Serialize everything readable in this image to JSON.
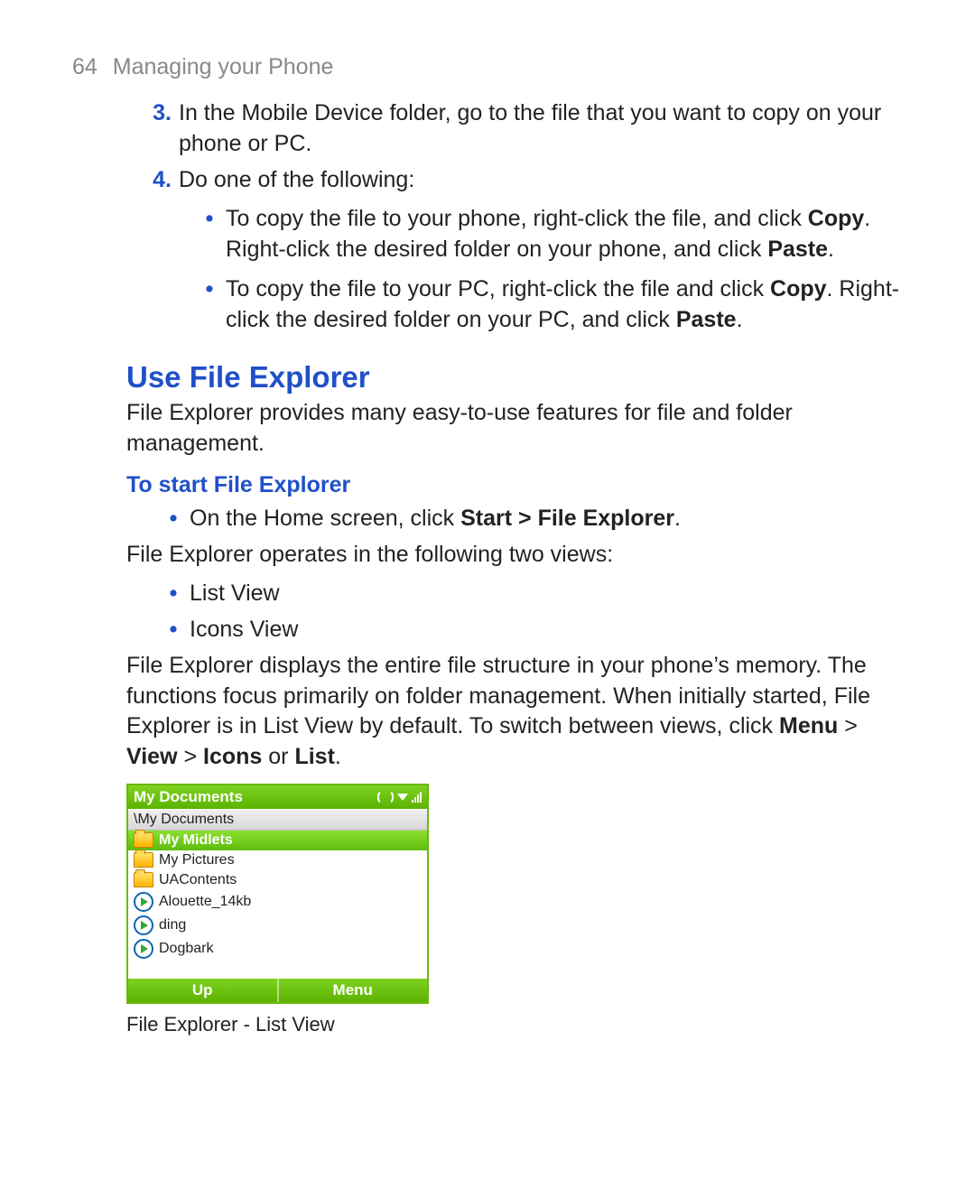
{
  "header": {
    "page_number": "64",
    "section_title": "Managing your Phone"
  },
  "steps": {
    "s3_num": "3.",
    "s3_text": "In the Mobile Device folder, go to the file that you want to copy on your phone or PC.",
    "s4_num": "4.",
    "s4_text": "Do one of the following:"
  },
  "s4_bullets": {
    "b1_pre": "To copy the file to your phone, right-click the file, and click ",
    "b1_copy": "Copy",
    "b1_mid": ". Right-click the desired folder on your phone, and click ",
    "b1_paste": "Paste",
    "b1_end": ".",
    "b2_pre": "To copy the file to your PC, right-click the file and click ",
    "b2_copy": "Copy",
    "b2_mid": ". Right-click the desired folder on your PC, and click ",
    "b2_paste": "Paste",
    "b2_end": "."
  },
  "section2": {
    "heading": "Use File Explorer",
    "para1": "File Explorer provides many easy-to-use features for file and folder management.",
    "sub_heading": "To start File Explorer",
    "start_pre": "On the Home screen, click ",
    "start_bold": "Start > File Explorer",
    "start_end": ".",
    "para2": "File Explorer operates in the following two views:",
    "views": {
      "v1": "List View",
      "v2": "Icons View"
    },
    "para3_pre": "File Explorer displays the entire file structure in your phone’s memory. The functions focus primarily on folder management. When initially started, File Explorer is in List View by default. To switch between views, click ",
    "para3_menu": "Menu",
    "para3_gt1": " > ",
    "para3_view": "View",
    "para3_gt2": " > ",
    "para3_icons": "Icons",
    "para3_or": " or ",
    "para3_list": "List",
    "para3_end": "."
  },
  "screenshot": {
    "title": "My Documents",
    "path": "\\My Documents",
    "items": [
      {
        "type": "folder",
        "name": "My Midlets",
        "selected": true
      },
      {
        "type": "folder",
        "name": "My Pictures",
        "selected": false
      },
      {
        "type": "folder",
        "name": "UAContents",
        "selected": false
      },
      {
        "type": "media",
        "name": "Alouette_14kb",
        "selected": false
      },
      {
        "type": "media",
        "name": "ding",
        "selected": false
      },
      {
        "type": "media",
        "name": "Dogbark",
        "selected": false
      }
    ],
    "softkey_left": "Up",
    "softkey_right": "Menu",
    "caption": "File Explorer - List View"
  }
}
